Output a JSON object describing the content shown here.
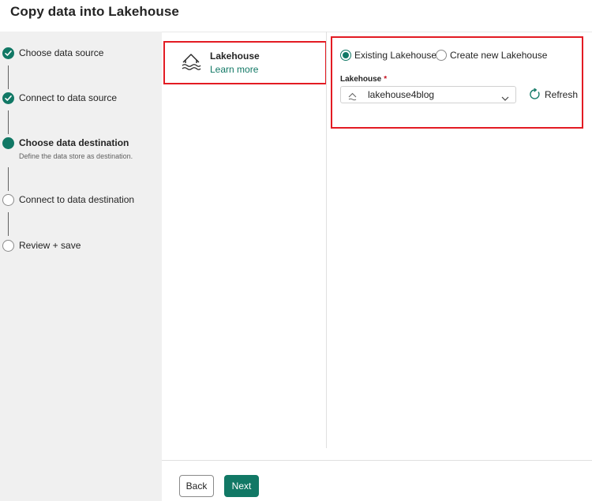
{
  "dialog": {
    "title": "Copy data into Lakehouse"
  },
  "steps": [
    {
      "label": "Choose data source",
      "state": "done"
    },
    {
      "label": "Connect to data source",
      "state": "done"
    },
    {
      "label": "Choose data destination",
      "state": "current",
      "description": "Define the data store as destination."
    },
    {
      "label": "Connect to data destination",
      "state": "todo"
    },
    {
      "label": "Review + save",
      "state": "todo"
    }
  ],
  "destination_card": {
    "name": "Lakehouse",
    "link": "Learn more",
    "icon": "lakehouse-icon"
  },
  "config": {
    "radio_existing": "Existing Lakehouse",
    "radio_new": "Create new Lakehouse",
    "selected_option": "Existing Lakehouse",
    "field_label": "Lakehouse",
    "required_mark": "*",
    "selected_value": "lakehouse4blog",
    "refresh_label": "Refresh"
  },
  "footer": {
    "back_label": "Back",
    "next_label": "Next"
  },
  "colors": {
    "accent": "#117865",
    "highlight": "#e31b23",
    "sidebar_bg": "#f0f0f0"
  }
}
